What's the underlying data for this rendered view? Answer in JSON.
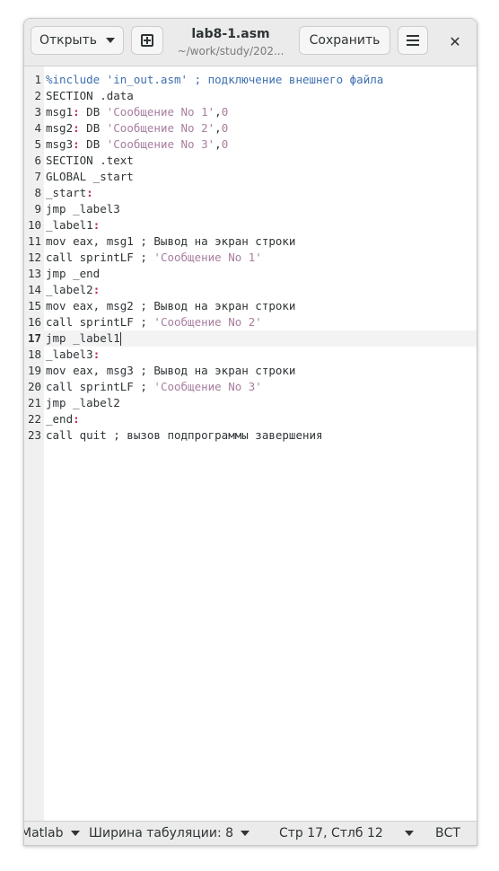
{
  "header": {
    "open_label": "Открыть",
    "save_label": "Сохранить",
    "file_name": "lab8-1.asm",
    "file_path": "~/work/study/202..."
  },
  "editor": {
    "current_line": 17,
    "lines": [
      {
        "n": "1",
        "t": [
          {
            "k": "pre",
            "v": "%include 'in_out.asm' ; подключение внешнего файла"
          }
        ]
      },
      {
        "n": "2",
        "t": [
          {
            "k": "txt",
            "v": "SECTION .data"
          }
        ]
      },
      {
        "n": "3",
        "t": [
          {
            "k": "txt",
            "v": "msg1"
          },
          {
            "k": "colon",
            "v": ":"
          },
          {
            "k": "txt",
            "v": " DB "
          },
          {
            "k": "str",
            "v": "'Сообщение No 1'"
          },
          {
            "k": "txt",
            "v": ","
          },
          {
            "k": "num",
            "v": "0"
          }
        ]
      },
      {
        "n": "4",
        "t": [
          {
            "k": "txt",
            "v": "msg2"
          },
          {
            "k": "colon",
            "v": ":"
          },
          {
            "k": "txt",
            "v": " DB "
          },
          {
            "k": "str",
            "v": "'Сообщение No 2'"
          },
          {
            "k": "txt",
            "v": ","
          },
          {
            "k": "num",
            "v": "0"
          }
        ]
      },
      {
        "n": "5",
        "t": [
          {
            "k": "txt",
            "v": "msg3"
          },
          {
            "k": "colon",
            "v": ":"
          },
          {
            "k": "txt",
            "v": " DB "
          },
          {
            "k": "str",
            "v": "'Сообщение No 3'"
          },
          {
            "k": "txt",
            "v": ","
          },
          {
            "k": "num",
            "v": "0"
          }
        ]
      },
      {
        "n": "6",
        "t": [
          {
            "k": "txt",
            "v": "SECTION .text"
          }
        ]
      },
      {
        "n": "7",
        "t": [
          {
            "k": "txt",
            "v": "GLOBAL _start"
          }
        ]
      },
      {
        "n": "8",
        "t": [
          {
            "k": "txt",
            "v": "_start"
          },
          {
            "k": "colon",
            "v": ":"
          }
        ]
      },
      {
        "n": "9",
        "t": [
          {
            "k": "txt",
            "v": "jmp _label3"
          }
        ]
      },
      {
        "n": "10",
        "t": [
          {
            "k": "txt",
            "v": "_label1"
          },
          {
            "k": "colon",
            "v": ":"
          }
        ]
      },
      {
        "n": "11",
        "t": [
          {
            "k": "txt",
            "v": "mov eax, msg1 ; Вывод на экран строки"
          }
        ]
      },
      {
        "n": "12",
        "t": [
          {
            "k": "txt",
            "v": "call sprintLF ; "
          },
          {
            "k": "str",
            "v": "'Сообщение No 1'"
          }
        ]
      },
      {
        "n": "13",
        "t": [
          {
            "k": "txt",
            "v": "jmp _end"
          }
        ]
      },
      {
        "n": "14",
        "t": [
          {
            "k": "txt",
            "v": "_label2"
          },
          {
            "k": "colon",
            "v": ":"
          }
        ]
      },
      {
        "n": "15",
        "t": [
          {
            "k": "txt",
            "v": "mov eax, msg2 ; Вывод на экран строки"
          }
        ]
      },
      {
        "n": "16",
        "t": [
          {
            "k": "txt",
            "v": "call sprintLF ; "
          },
          {
            "k": "str",
            "v": "'Сообщение No 2'"
          }
        ]
      },
      {
        "n": "17",
        "t": [
          {
            "k": "txt",
            "v": "jmp _label1"
          }
        ],
        "cursor": true
      },
      {
        "n": "18",
        "t": [
          {
            "k": "txt",
            "v": "_label3"
          },
          {
            "k": "colon",
            "v": ":"
          }
        ]
      },
      {
        "n": "19",
        "t": [
          {
            "k": "txt",
            "v": "mov eax, msg3 ; Вывод на экран строки"
          }
        ]
      },
      {
        "n": "20",
        "t": [
          {
            "k": "txt",
            "v": "call sprintLF ; "
          },
          {
            "k": "str",
            "v": "'Сообщение No 3'"
          }
        ]
      },
      {
        "n": "21",
        "t": [
          {
            "k": "txt",
            "v": "jmp _label2"
          }
        ]
      },
      {
        "n": "22",
        "t": [
          {
            "k": "txt",
            "v": "_end"
          },
          {
            "k": "colon",
            "v": ":"
          }
        ]
      },
      {
        "n": "23",
        "t": [
          {
            "k": "txt",
            "v": "call quit ; вызов подпрограммы завершения"
          }
        ]
      }
    ]
  },
  "statusbar": {
    "language": "Matlab",
    "tab_width": "Ширина табуляции: 8",
    "position": "Стр 17, Стлб 12",
    "mode": "ВСТ"
  },
  "colors": {
    "string": "#a77ea0",
    "preprocessor": "#3e6faf",
    "label_colon": "#c4215f"
  }
}
